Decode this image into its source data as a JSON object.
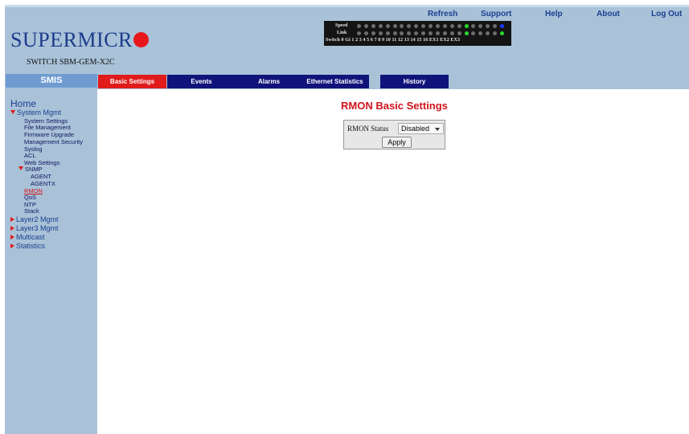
{
  "header": {
    "links": {
      "refresh": "Refresh",
      "support": "Support",
      "help": "Help",
      "about": "About",
      "logout": "Log Out"
    },
    "logo_text": "SUPERMICR",
    "model": "SWITCH SBM-GEM-X2C",
    "status_panel": {
      "speed_label": "Speed",
      "link_label": "Link",
      "port_row": "Switch 0 Gi  1  2  3  4  5  6  7  8  9 10 11 12 13 14 15 16 EX1 EX2 EX3",
      "colors": {
        "off": "#6d6d6d",
        "green": "#29d82f",
        "blue": "#1c3cff"
      }
    }
  },
  "nav": {
    "smis_label": "SMIS",
    "tabs": [
      "Basic Settings",
      "Events",
      "Alarms",
      "Ethernet Statistics",
      "History"
    ],
    "active_tab": "Basic Settings"
  },
  "sidebar": {
    "home": "Home",
    "system_mgmt": "System Mgmt",
    "system_items": [
      "System Settings",
      "File Management",
      "Firmware Upgrade",
      "Management Security",
      "Syslog",
      "ACL",
      "Web Settings"
    ],
    "snmp": "SNMP",
    "snmp_items": [
      "AGENT",
      "AGENTX"
    ],
    "after_snmp": [
      "RMON",
      "QoS",
      "NTP",
      "Stack"
    ],
    "current": "RMON",
    "sections": [
      "Layer2 Mgmt",
      "Layer3 Mgmt",
      "Multicast",
      "Statistics"
    ]
  },
  "main": {
    "title": "RMON Basic Settings",
    "form": {
      "label": "RMON Status",
      "select_value": "Disabled",
      "apply_label": "Apply"
    }
  },
  "colors": {
    "accent_red": "#e01b1b",
    "tab_navy": "#10137a",
    "panel_blue": "#a9c2d8",
    "smis_blue": "#6f9bd1"
  }
}
